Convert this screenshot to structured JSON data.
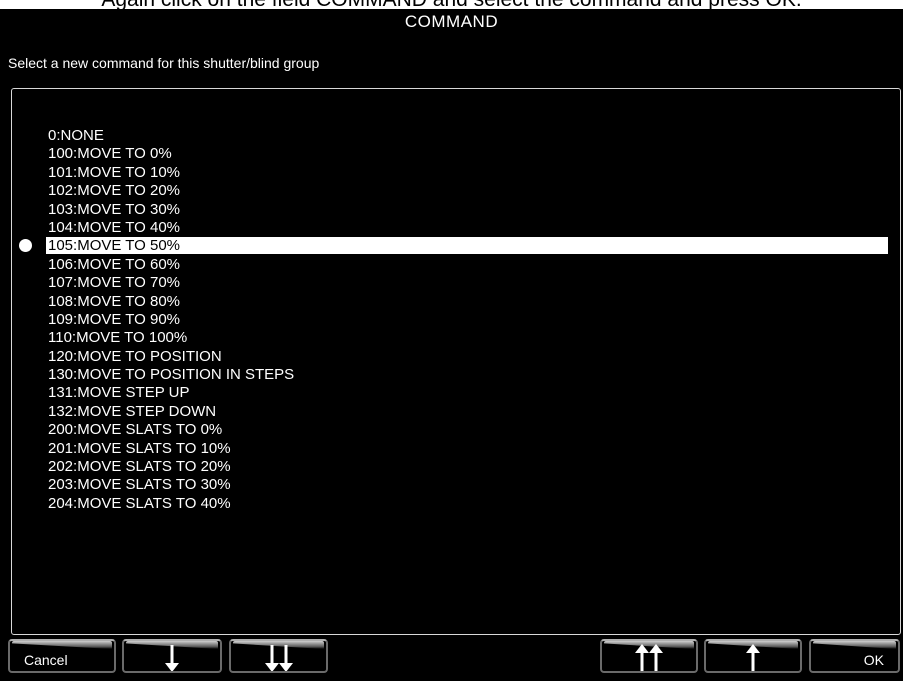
{
  "instruction": "Again click on the field COMMAND and select the command and press OK.",
  "dialog": {
    "title": "COMMAND",
    "subtitle": "Select a new command for this shutter/blind group"
  },
  "commands": [
    {
      "label": "0:NONE",
      "selected": false
    },
    {
      "label": "100:MOVE TO 0%",
      "selected": false
    },
    {
      "label": "101:MOVE TO 10%",
      "selected": false
    },
    {
      "label": "102:MOVE TO 20%",
      "selected": false
    },
    {
      "label": "103:MOVE TO 30%",
      "selected": false
    },
    {
      "label": "104:MOVE TO 40%",
      "selected": false
    },
    {
      "label": "105:MOVE TO 50%",
      "selected": true
    },
    {
      "label": "106:MOVE TO 60%",
      "selected": false
    },
    {
      "label": "107:MOVE TO 70%",
      "selected": false
    },
    {
      "label": "108:MOVE TO 80%",
      "selected": false
    },
    {
      "label": "109:MOVE TO 90%",
      "selected": false
    },
    {
      "label": "110:MOVE TO 100%",
      "selected": false
    },
    {
      "label": "120:MOVE TO POSITION",
      "selected": false
    },
    {
      "label": "130:MOVE TO POSITION IN STEPS",
      "selected": false
    },
    {
      "label": "131:MOVE STEP UP",
      "selected": false
    },
    {
      "label": "132:MOVE STEP DOWN",
      "selected": false
    },
    {
      "label": "200:MOVE SLATS TO 0%",
      "selected": false
    },
    {
      "label": "201:MOVE SLATS TO 10%",
      "selected": false
    },
    {
      "label": "202:MOVE SLATS TO 20%",
      "selected": false
    },
    {
      "label": "203:MOVE SLATS TO 30%",
      "selected": false
    },
    {
      "label": "204:MOVE SLATS TO 40%",
      "selected": false
    }
  ],
  "buttons": {
    "cancel": "Cancel",
    "ok": "OK",
    "down_icon": "arrow-down-icon",
    "page_down_icon": "double-arrow-down-icon",
    "page_up_icon": "double-arrow-up-icon",
    "up_icon": "arrow-up-icon"
  },
  "colors": {
    "background": "#000000",
    "text": "#ffffff",
    "selected_bg": "#ffffff",
    "selected_text": "#000000"
  }
}
